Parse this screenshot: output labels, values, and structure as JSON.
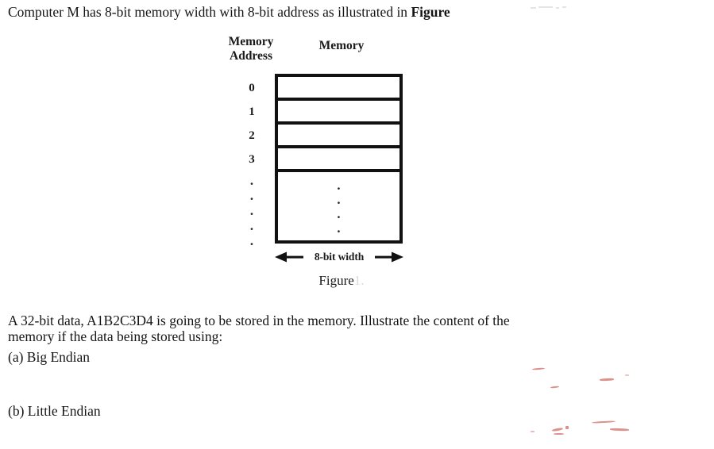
{
  "document": {
    "intro": {
      "text_before_ref": "Computer M has 8-bit memory width with 8-bit address as illustrated in ",
      "reference_label": "Figure"
    },
    "figure": {
      "header_address": "Memory\nAddress",
      "header_address_line1": "Memory",
      "header_address_line2": "Address",
      "header_memory": "Memory",
      "address_labels": [
        "0",
        "1",
        "2",
        "3"
      ],
      "address_continuation_dots": [
        "·",
        "·",
        "·",
        "·",
        "·"
      ],
      "cell_continuation_dots": [
        "·",
        "·",
        "·",
        "·"
      ],
      "cell_count": 4,
      "width_label": "8-bit width",
      "caption": "Figure",
      "caption_faded_suffix": "1.",
      "border_color": "#111111",
      "cell_fill": "#ffffff"
    },
    "question": {
      "line1": "A 32-bit data, A1B2C3D4 is going to be stored in the memory. Illustrate the content of the",
      "line2": "memory if the data being stored using:",
      "option_a": "(a) Big Endian",
      "option_b": "(b) Little Endian"
    },
    "artifacts": {
      "top_right_gray": "faint-scan-marks",
      "bottom_right_red": "faded-red-ink-marks",
      "red_color": "#c0392b"
    }
  }
}
